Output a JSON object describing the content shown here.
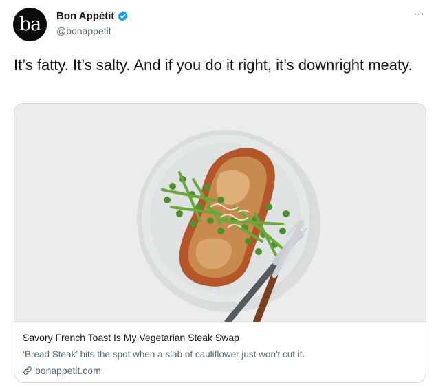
{
  "author": {
    "avatar_text": "ba",
    "display_name": "Bon Appétit",
    "handle": "@bonappetit",
    "verified": true
  },
  "more_icon": "···",
  "tweet": {
    "text": "It’s fatty. It’s salty. And if you do it right, it’s downright meaty."
  },
  "card": {
    "image_subject": "french-toast-plate-with-peas-fork-knife",
    "title": "Savory French Toast Is My Vegetarian Steak Swap",
    "description": "‘Bread Steak’ hits the spot when a slab of cauliflower just won't cut it.",
    "domain": "bonappetit.com"
  },
  "colors": {
    "text_primary": "#0f1419",
    "text_secondary": "#536471",
    "verified_blue": "#1d9bf0",
    "border": "#cfd9de",
    "card_bg": "#ececec"
  }
}
